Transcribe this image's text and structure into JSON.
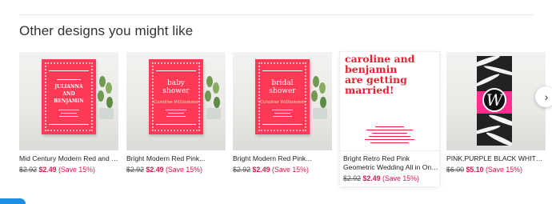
{
  "section": {
    "title": "Other designs you might like"
  },
  "carousel": {
    "next_icon": "chevron-right-icon",
    "items": [
      {
        "title": "Mid Century Modern Red and Pi...",
        "title2": "",
        "old_price": "$2.92",
        "new_price": "$2.49",
        "save": "(Save 15%)",
        "art": {
          "line1": "JULIANNA",
          "line2": "AND",
          "line3": "BENJAMIN",
          "script": ""
        }
      },
      {
        "title": "Bright Modern Red Pink...",
        "title2": "",
        "old_price": "$2.92",
        "new_price": "$2.49",
        "save": "(Save 15%)",
        "art": {
          "line1": "baby",
          "line2": "shower",
          "line3": "",
          "script": "Caroline Williamson"
        }
      },
      {
        "title": "Bright Modern Red Pink...",
        "title2": "",
        "old_price": "$2.92",
        "new_price": "$2.49",
        "save": "(Save 15%)",
        "art": {
          "line1": "bridal",
          "line2": "shower",
          "line3": "",
          "script": "Caroline Williamson"
        }
      },
      {
        "title": "Bright Retro Red Pink",
        "title2": "Geometric Wedding All in One...",
        "old_price": "$2.92",
        "new_price": "$2.49",
        "save": "(Save 15%)",
        "art": {
          "headline": [
            "caroline and",
            "benjamin",
            "are getting",
            "married!"
          ]
        }
      },
      {
        "title": "PINK,PURPLE BLACK WHITE...",
        "title2": "",
        "old_price": "$6.00",
        "new_price": "$5.10",
        "save": "(Save 15%)",
        "art": {
          "monogram": "W"
        }
      }
    ]
  },
  "colors": {
    "sale": "#d8194b",
    "invite_red": "#ff3a56",
    "text_red": "#e8212f",
    "accent_blue": "#1a8fe3"
  }
}
